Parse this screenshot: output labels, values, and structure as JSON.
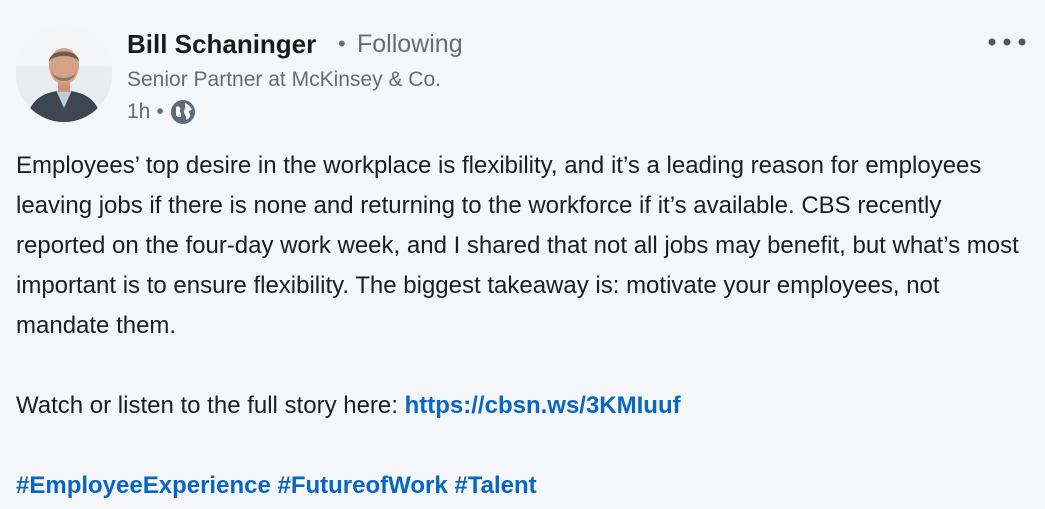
{
  "author": {
    "name": "Bill Schaninger",
    "follow_status": "Following",
    "headline": "Senior Partner at McKinsey & Co.",
    "time_ago": "1h",
    "separator": "•",
    "visibility_icon": "globe-icon",
    "avatar_icon": "avatar"
  },
  "menu": {
    "icon": "more-horizontal-icon"
  },
  "post": {
    "paragraph": "Employees’ top desire in the workplace is flexibility, and it’s a leading reason for employees leaving jobs if there is none and returning to the workforce if it’s available. CBS recently reported on the four-day work week, and I shared that not all jobs may benefit, but what’s most important is to ensure flexibility. The biggest takeaway is: motivate your employees, not mandate them.",
    "watch_text": "Watch or listen to the full story here: ",
    "link_text": "https://cbsn.ws/3KMIuuf",
    "hashtags": [
      "#EmployeeExperience",
      "#FutureofWork",
      "#Talent"
    ]
  },
  "colors": {
    "link": "#0a66c2",
    "secondary_text": "#6b6b6b",
    "background": "#f4f6f9"
  }
}
